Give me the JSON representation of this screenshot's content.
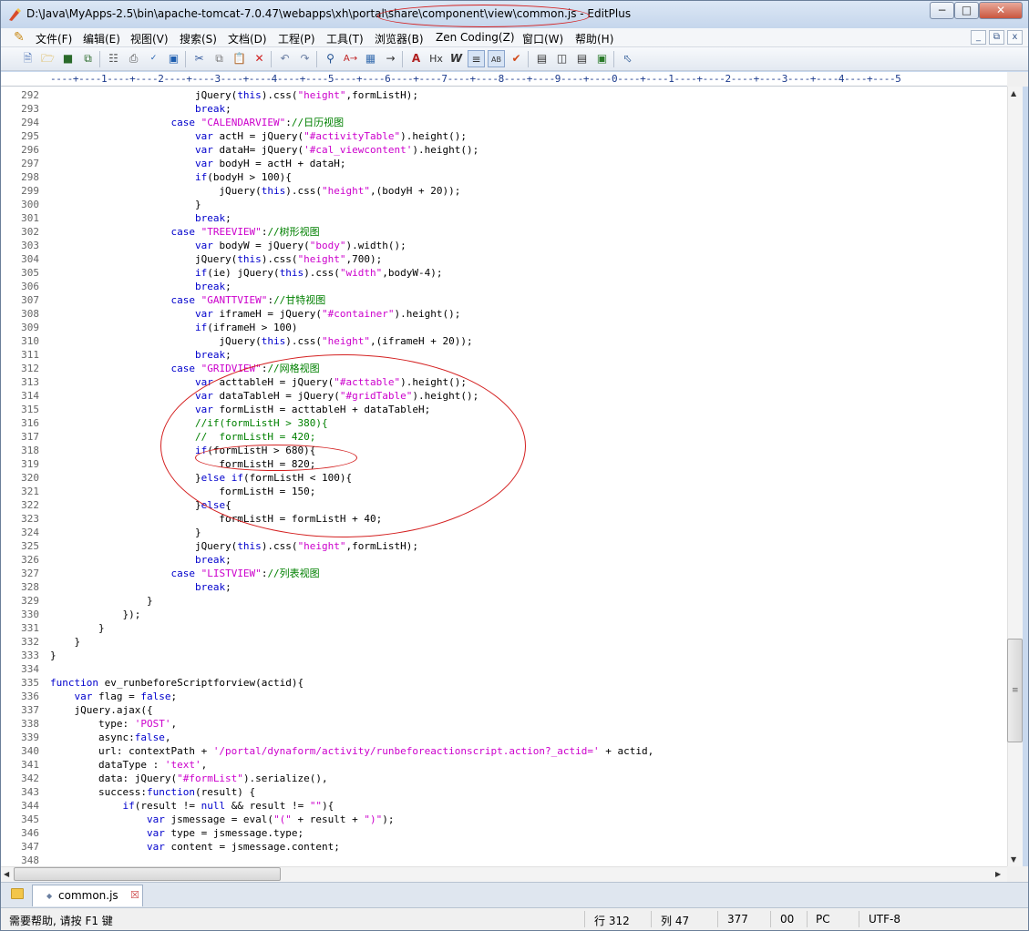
{
  "window": {
    "title": "D:\\Java\\MyApps-2.5\\bin\\apache-tomcat-7.0.47\\webapps\\xh\\portal\\share\\component\\view\\common.js - EditPlus",
    "controls": {
      "minimize": "−",
      "maximize": "□",
      "close": "✕"
    }
  },
  "menu": {
    "items": [
      "文件(F)",
      "编辑(E)",
      "视图(V)",
      "搜索(S)",
      "文档(D)",
      "工程(P)",
      "工具(T)",
      "浏览器(B)",
      "Zen Coding(Z)",
      "窗口(W)",
      "帮助(H)"
    ],
    "mdi": {
      "minimize": "_",
      "restore": "⧉",
      "close": "x"
    }
  },
  "toolbar": {
    "buttons": [
      "new-file-icon",
      "open-folder-icon",
      "save-icon",
      "save-all-icon",
      "print-preview-icon",
      "print-icon",
      "spell-check-icon",
      "browser-icon",
      "cut-icon",
      "copy-icon",
      "paste-icon",
      "delete-icon",
      "undo-icon",
      "redo-icon",
      "find-icon",
      "replace-icon",
      "find-in-files-icon",
      "goto-icon",
      "font-icon",
      "hx-icon",
      "word-wrap-icon",
      "line-number-icon",
      "column-icon",
      "check-icon",
      "cliptext-icon",
      "directory-icon",
      "output-icon",
      "fullscreen-icon",
      "help-pointer-icon"
    ]
  },
  "ruler": {
    "text": "----+----1----+----2----+----3----+----4----+----5----+----6----+----7----+----8----+----9----+----0----+----1----+----2----+----3----+----4----+----5"
  },
  "editor": {
    "lines": [
      {
        "n": "292",
        "t": "                        jQuery(this).css(\"height\",formListH);"
      },
      {
        "n": "293",
        "t": "                        break;"
      },
      {
        "n": "294",
        "t": "                    case \"CALENDARVIEW\"://日历视图"
      },
      {
        "n": "295",
        "t": "                        var actH = jQuery(\"#activityTable\").height();"
      },
      {
        "n": "296",
        "t": "                        var dataH= jQuery('#cal_viewcontent').height();"
      },
      {
        "n": "297",
        "t": "                        var bodyH = actH + dataH;"
      },
      {
        "n": "298",
        "t": "                        if(bodyH > 100){"
      },
      {
        "n": "299",
        "t": "                            jQuery(this).css(\"height\",(bodyH + 20));"
      },
      {
        "n": "300",
        "t": "                        }"
      },
      {
        "n": "301",
        "t": "                        break;"
      },
      {
        "n": "302",
        "t": "                    case \"TREEVIEW\"://树形视图"
      },
      {
        "n": "303",
        "t": "                        var bodyW = jQuery(\"body\").width();"
      },
      {
        "n": "304",
        "t": "                        jQuery(this).css(\"height\",700);"
      },
      {
        "n": "305",
        "t": "                        if(ie) jQuery(this).css(\"width\",bodyW-4);"
      },
      {
        "n": "306",
        "t": "                        break;"
      },
      {
        "n": "307",
        "t": "                    case \"GANTTVIEW\"://甘特视图"
      },
      {
        "n": "308",
        "t": "                        var iframeH = jQuery(\"#container\").height();"
      },
      {
        "n": "309",
        "t": "                        if(iframeH > 100)"
      },
      {
        "n": "310",
        "t": "                            jQuery(this).css(\"height\",(iframeH + 20));"
      },
      {
        "n": "311",
        "t": "                        break;"
      },
      {
        "n": "312",
        "t": "                    case \"GRIDVIEW\"://网格视图"
      },
      {
        "n": "313",
        "t": "                        var acttableH = jQuery(\"#acttable\").height();"
      },
      {
        "n": "314",
        "t": "                        var dataTableH = jQuery(\"#gridTable\").height();"
      },
      {
        "n": "315",
        "t": "                        var formListH = acttableH + dataTableH;"
      },
      {
        "n": "316",
        "t": "                        //if(formListH > 380){"
      },
      {
        "n": "317",
        "t": "                        //  formListH = 420;"
      },
      {
        "n": "318",
        "t": "                        if(formListH > 680){"
      },
      {
        "n": "319",
        "t": "                            formListH = 820;"
      },
      {
        "n": "320",
        "t": "                        }else if(formListH < 100){"
      },
      {
        "n": "321",
        "t": "                            formListH = 150;"
      },
      {
        "n": "322",
        "t": "                        }else{"
      },
      {
        "n": "323",
        "t": "                            formListH = formListH + 40;"
      },
      {
        "n": "324",
        "t": "                        }"
      },
      {
        "n": "325",
        "t": "                        jQuery(this).css(\"height\",formListH);"
      },
      {
        "n": "326",
        "t": "                        break;"
      },
      {
        "n": "327",
        "t": "                    case \"LISTVIEW\"://列表视图"
      },
      {
        "n": "328",
        "t": "                        break;"
      },
      {
        "n": "329",
        "t": "                }"
      },
      {
        "n": "330",
        "t": "            });"
      },
      {
        "n": "331",
        "t": "        }"
      },
      {
        "n": "332",
        "t": "    }"
      },
      {
        "n": "333",
        "t": "}"
      },
      {
        "n": "334",
        "t": ""
      },
      {
        "n": "335",
        "t": "function ev_runbeforeScriptforview(actid){"
      },
      {
        "n": "336",
        "t": "    var flag = false;"
      },
      {
        "n": "337",
        "t": "    jQuery.ajax({"
      },
      {
        "n": "338",
        "t": "        type: 'POST',"
      },
      {
        "n": "339",
        "t": "        async:false,"
      },
      {
        "n": "340",
        "t": "        url: contextPath + '/portal/dynaform/activity/runbeforeactionscript.action?_actid=' + actid,"
      },
      {
        "n": "341",
        "t": "        dataType : 'text',"
      },
      {
        "n": "342",
        "t": "        data: jQuery(\"#formList\").serialize(),"
      },
      {
        "n": "343",
        "t": "        success:function(result) {"
      },
      {
        "n": "344",
        "t": "            if(result != null && result != \"\"){"
      },
      {
        "n": "345",
        "t": "                var jsmessage = eval(\"(\" + result + \")\");"
      },
      {
        "n": "346",
        "t": "                var type = jsmessage.type;"
      },
      {
        "n": "347",
        "t": "                var content = jsmessage.content;"
      },
      {
        "n": "348",
        "t": ""
      }
    ]
  },
  "tabs": {
    "items": [
      {
        "label": "common.js",
        "close": "☒"
      }
    ]
  },
  "status": {
    "help": "需要帮助, 请按 F1 键",
    "line": "行 312",
    "column": "列 47",
    "total": "377",
    "sel": "00",
    "platform": "PC",
    "encoding": "UTF-8"
  },
  "colors": {
    "keyword": "#0000cc",
    "string": "#cc00cc",
    "comment": "#008000",
    "annotation": "#d42020"
  }
}
